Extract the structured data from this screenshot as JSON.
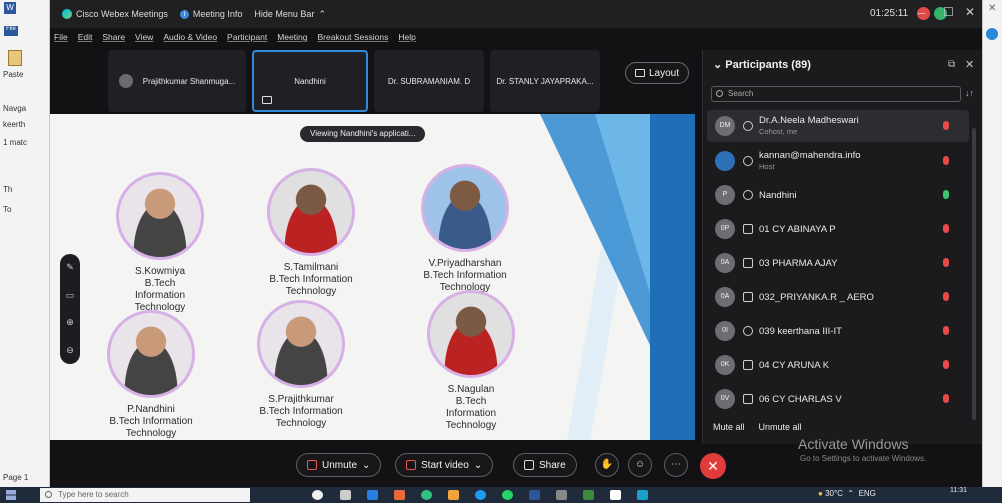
{
  "word": {
    "file_label": "File",
    "paste_label": "Paste",
    "sidebar_texts": [
      "Navga",
      "keerth",
      "1 matc",
      "Th",
      "To",
      "Page 1"
    ]
  },
  "webex": {
    "app_name": "Cisco Webex Meetings",
    "meeting_info": "Meeting Info",
    "hide_menu": "Hide Menu Bar",
    "time": "01:25:11",
    "menu": [
      "File",
      "Edit",
      "Share",
      "View",
      "Audio & Video",
      "Participant",
      "Meeting",
      "Breakout Sessions",
      "Help"
    ],
    "video_tiles": [
      "Prajithkumar Shanmuga...",
      "Nandhini",
      "Dr. SUBRAMANIAM. D",
      "Dr. STANLY JAYAPRAKA..."
    ],
    "layout_label": "Layout",
    "viewing_label": "Viewing Nandhini's applicati...",
    "controls": {
      "unmute": "Unmute",
      "start_video": "Start video",
      "share": "Share"
    },
    "activate_title": "Activate Windows",
    "activate_sub": "Go to Settings to activate Windows."
  },
  "slide": {
    "people": [
      {
        "name": "S.Kowmiya",
        "line2": "B.Tech",
        "line3": "Information",
        "line4": "Technology"
      },
      {
        "name": "S.Tamilmani",
        "line2": "B.Tech Information",
        "line3": "Technology",
        "line4": ""
      },
      {
        "name": "V.Priyadharshan",
        "line2": "B.Tech Information",
        "line3": "Technology",
        "line4": ""
      },
      {
        "name": "P.Nandhini",
        "line2": "B.Tech Information",
        "line3": "Technology",
        "line4": ""
      },
      {
        "name": "S.Prajithkumar",
        "line2": "B.Tech Information",
        "line3": "Technology",
        "line4": ""
      },
      {
        "name": "S.Nagulan",
        "line2": "B.Tech",
        "line3": "Information",
        "line4": "Technology"
      }
    ]
  },
  "participants": {
    "title": "Participants (89)",
    "search_placeholder": "Search",
    "rows": [
      {
        "initials": "DM",
        "name": "Dr.A.Neela Madheswari",
        "sub": "Cohost, me"
      },
      {
        "initials": "",
        "name": "kannan@mahendra.info",
        "sub": "Host"
      },
      {
        "initials": "P",
        "name": "Nandhini",
        "sub": ""
      },
      {
        "initials": "0P",
        "name": "01 CY ABINAYA P",
        "sub": ""
      },
      {
        "initials": "0A",
        "name": "03 PHARMA AJAY",
        "sub": ""
      },
      {
        "initials": "0A",
        "name": "032_PRIYANKA.R _ AERO",
        "sub": ""
      },
      {
        "initials": "0I",
        "name": "039 keerthana III-IT",
        "sub": ""
      },
      {
        "initials": "0K",
        "name": "04 CY ARUNA K",
        "sub": ""
      },
      {
        "initials": "0V",
        "name": "06 CY CHARLAS V",
        "sub": ""
      }
    ],
    "mute_all": "Mute all",
    "unmute_all": "Unmute all"
  },
  "taskbar": {
    "search_placeholder": "Type here to search",
    "weather": "30°C",
    "lang": "ENG",
    "time": "11:31"
  }
}
